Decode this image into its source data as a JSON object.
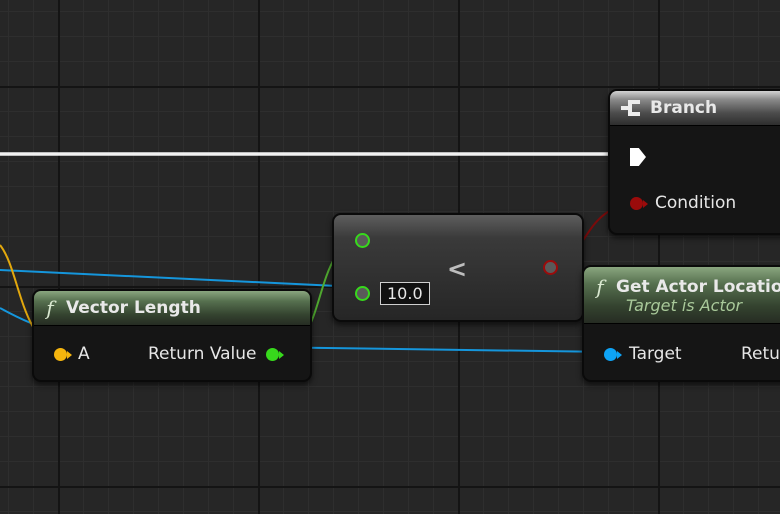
{
  "nodes": {
    "branch": {
      "title": "Branch",
      "pins": {
        "condition": "Condition"
      }
    },
    "vector_length": {
      "title": "Vector Length",
      "pins": {
        "input_a": "A",
        "return_value": "Return Value"
      }
    },
    "compare": {
      "operator": "<",
      "input_b_value": "10.0"
    },
    "get_actor_location": {
      "title": "Get Actor Locatio",
      "subtitle": "Target is Actor",
      "pins": {
        "target": "Target",
        "return_value": "Retu"
      }
    }
  },
  "icons": {
    "branch_icon": "branch-icon",
    "function_icon": "f"
  },
  "colors": {
    "exec_wire": "#ffffff",
    "vector_wire": "#f5b50e",
    "float_wire": "#37d91c",
    "bool_wire": "#9b0b0b",
    "object_wire": "#0ea3f5",
    "function_header": "#56704f",
    "background": "#262626"
  }
}
